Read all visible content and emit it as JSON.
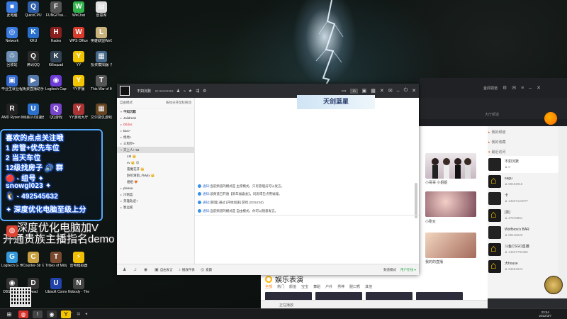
{
  "desktop_icons": [
    {
      "label": "此电脑",
      "icon": "computer-icon",
      "color": "#3b7be0",
      "glyph": "■"
    },
    {
      "label": "QuickCPU",
      "icon": "cpu-icon",
      "color": "#2e5fa8",
      "glyph": "Q"
    },
    {
      "label": "FUNGITrai...",
      "icon": "tool-icon",
      "color": "#555555",
      "glyph": "F"
    },
    {
      "label": "WeChat",
      "icon": "wechat-icon",
      "color": "#2fb24a",
      "glyph": "W"
    },
    {
      "label": "创意库",
      "icon": "doc-icon",
      "color": "#dddddd",
      "glyph": "▤"
    },
    {
      "label": "Network",
      "icon": "network-icon",
      "color": "#3b7be0",
      "glyph": "◎"
    },
    {
      "label": "KRU",
      "icon": "game-icon",
      "color": "#2a6fcc",
      "glyph": "K"
    },
    {
      "label": "Hades",
      "icon": "hades-icon",
      "color": "#8a1f1f",
      "glyph": "H"
    },
    {
      "label": "WPS Office",
      "icon": "wps-icon",
      "color": "#d93b2b",
      "glyph": "W"
    },
    {
      "label": "英雄联盟WeGame版",
      "icon": "lol-icon",
      "color": "#c9b27c",
      "glyph": "L"
    },
    {
      "label": "回收站",
      "icon": "recycle-bin-icon",
      "color": "#6d8fb3",
      "glyph": "♲"
    },
    {
      "label": "腾讯QQ",
      "icon": "qq-icon",
      "color": "#2a2a2a",
      "glyph": "Q"
    },
    {
      "label": "Killsquad",
      "icon": "killsquad-icon",
      "color": "#334455",
      "glyph": "K"
    },
    {
      "label": "YY",
      "icon": "yy-icon",
      "color": "#f3c400",
      "glyph": "Y"
    },
    {
      "label": "投资模拟器: 打工篇",
      "icon": "game-icon",
      "color": "#446688",
      "glyph": "▦"
    },
    {
      "label": "毕业生就业程序",
      "icon": "app-icon",
      "color": "#3366cc",
      "glyph": "▣"
    },
    {
      "label": "免费直播助手",
      "icon": "live-icon",
      "color": "#5577aa",
      "glyph": "▶"
    },
    {
      "label": "Logitech Capture",
      "icon": "logitech-icon",
      "color": "#6d3bd6",
      "glyph": "◉"
    },
    {
      "label": "YY开播",
      "icon": "yy-live-icon",
      "color": "#f3c400",
      "glyph": "Y"
    },
    {
      "label": "This War of Mine",
      "icon": "game-icon",
      "color": "#555555",
      "glyph": "T"
    },
    {
      "label": "AMD Ryzen Master",
      "icon": "amd-icon",
      "color": "#222222",
      "glyph": "R"
    },
    {
      "label": "网易UU加速器",
      "icon": "uu-icon",
      "color": "#2a6fcc",
      "glyph": "U"
    },
    {
      "label": "QQ游戏",
      "icon": "qqgame-icon",
      "color": "#7744cc",
      "glyph": "Q"
    },
    {
      "label": "YY游戏大厅",
      "icon": "yy-game-icon",
      "color": "#aa3333",
      "glyph": "Y"
    },
    {
      "label": "文尔复仇游戏",
      "icon": "game-icon",
      "color": "#664422",
      "glyph": "▦"
    }
  ],
  "overlay_lines": [
    "喜欢的点点关注哦",
    "1 房管+优先车位",
    "2 当天车位",
    "12级找房子 🔊 群",
    "🔴 - 组号 ✦",
    "snowgl023 ✦",
    "🐧 - 492545632",
    "✦ 深度优化电脑至级上分"
  ],
  "overlay_big": [
    "深度优化电脑加V",
    "开通贵族主播指名demo"
  ],
  "lower_icons": [
    {
      "label": "Chrome",
      "icon": "chrome-icon",
      "color": "#dd4433",
      "glyph": "◍"
    },
    {
      "label": "Logitech G HUB",
      "icon": "ghub-icon",
      "color": "#3399dd",
      "glyph": "G"
    },
    {
      "label": "Counter-Str Global Off...",
      "icon": "csgo-icon",
      "color": "#c9a040",
      "glyph": "C"
    },
    {
      "label": "Tribes of Midgard",
      "icon": "game-icon",
      "color": "#7a4a30",
      "glyph": "T"
    },
    {
      "label": "雷电模拟器",
      "icon": "emulator-icon",
      "color": "#f0c000",
      "glyph": "⚡"
    },
    {
      "label": "Dead",
      "icon": "game-icon",
      "color": "#333333",
      "glyph": "D"
    },
    {
      "label": "Ubisoft Connect",
      "icon": "ubisoft-icon",
      "color": "#2244aa",
      "glyph": "U"
    },
    {
      "label": "Nobody - The Turna...",
      "icon": "game-icon",
      "color": "#444444",
      "glyph": "N"
    },
    {
      "label": "OBS Studio",
      "icon": "obs-icon",
      "color": "#333333",
      "glyph": "◉"
    }
  ],
  "chat": {
    "room_name": "不如沉默",
    "room_id": "ID 59102354",
    "online": "5",
    "banner": "天剑蓝星",
    "sidebar_mode": "自由模式",
    "sidebar_hint": "按住分开鼠标拖动",
    "channels": [
      {
        "label": "不知沉默",
        "style": "bold",
        "arrow": "▾"
      },
      {
        "label": "Jaildreak",
        "style": "normal",
        "arrow": "▸"
      },
      {
        "label": "Dildos",
        "style": "red",
        "arrow": "▸"
      },
      {
        "label": "Bus+",
        "style": "normal",
        "arrow": "▸"
      },
      {
        "label": "绝地+",
        "style": "normal",
        "arrow": "▸"
      },
      {
        "label": "三和罗+",
        "style": "normal",
        "arrow": "▸"
      },
      {
        "label": "天上人+ 56",
        "style": "hl",
        "arrow": "▾"
      },
      {
        "label": "LM 👑",
        "style": "sub",
        "arrow": ""
      },
      {
        "label": "vv 👑 😊",
        "style": "sub",
        "arrow": ""
      },
      {
        "label": "雷魔花开 👑",
        "style": "sub",
        "arrow": ""
      },
      {
        "label": "卧听清雨_FkMix 👑",
        "style": "sub",
        "arrow": ""
      },
      {
        "label": "姐姐 🦊",
        "style": "sub",
        "arrow": ""
      },
      {
        "label": "please.",
        "style": "normal",
        "arrow": "▸"
      },
      {
        "label": "冷刚盒",
        "style": "normal",
        "arrow": "▸"
      },
      {
        "label": "英雄轨迹+",
        "style": "normal",
        "arrow": "▸"
      },
      {
        "label": "暂运家",
        "style": "normal",
        "arrow": "▸"
      }
    ],
    "messages": [
      {
        "tag": "通知:",
        "text": "当前频道的模式是 主席模式，只有管理员可以发言。"
      },
      {
        "tag": "通知:",
        "text": "该频道已开通【新年福喜会】，同房得告点用福瑞。"
      },
      {
        "tag": "通知:",
        "text": "[管理] 通过 [开始加速] 游戏 (23:54:52)"
      },
      {
        "tag": "通知:",
        "text": "当前频道的模式是 自由模式，你可以随意发言。"
      }
    ],
    "footer": {
      "items": [
        "自由发言",
        "播放伴奏",
        "麦霸"
      ],
      "mode": "频道模式",
      "online": "用户在线 ●"
    }
  },
  "side_window": {
    "title": "金闻领道",
    "sub": "大厅频道",
    "my_channels": "我的频道",
    "my_favorites": "我的收藏",
    "recent": "最近访问",
    "items": [
      {
        "name": "不如沉默",
        "count": "0",
        "house": false
      },
      {
        "name": "sagu",
        "count": "59102015",
        "house": true
      },
      {
        "name": "卡",
        "count": "14537124077",
        "house": false
      },
      {
        "name": "[茶]",
        "count": "27576861",
        "house": true
      },
      {
        "name": "Wolfbros's BAR",
        "count": "99146220",
        "house": false
      },
      {
        "name": "斗鱼CSGO直播",
        "count": "14537784482",
        "house": true
      },
      {
        "name": "大house",
        "count": "94634224",
        "house": true
      }
    ]
  },
  "mid_window": {
    "section": "娱乐表演",
    "tabs": [
      "全部",
      "热门",
      "颜值",
      "宝宝",
      "舞蹈",
      "户外",
      "男神",
      "脱口秀",
      "其他"
    ],
    "video_labels": [
      "小哥哥 小姐姐",
      "小刚女",
      "我的的直播"
    ],
    "bottom_label": "正在播放"
  },
  "taskbar": {
    "time": "23:54",
    "date": "2022/3/7"
  }
}
